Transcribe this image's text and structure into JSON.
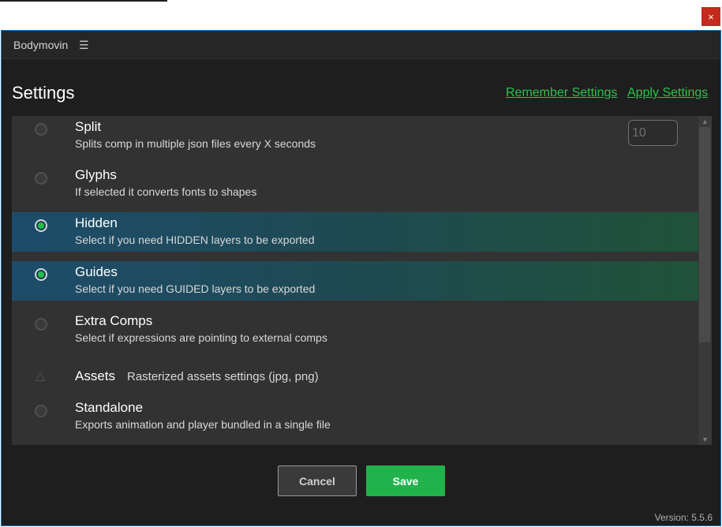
{
  "window": {
    "close_label": "×"
  },
  "header": {
    "app_title": "Bodymovin",
    "menu_icon": "☰"
  },
  "settings": {
    "title": "Settings",
    "remember_label": "Remember Settings",
    "apply_label": "Apply Settings"
  },
  "options": [
    {
      "title": "Split",
      "desc": "Splits comp in multiple json files every X seconds",
      "selected": false,
      "input_value": "10"
    },
    {
      "title": "Glyphs",
      "desc": "If selected it converts fonts to shapes",
      "selected": false
    },
    {
      "title": "Hidden",
      "desc": "Select if you need HIDDEN layers to be exported",
      "selected": true
    },
    {
      "title": "Guides",
      "desc": "Select if you need GUIDED layers to be exported",
      "selected": true
    },
    {
      "title": "Extra Comps",
      "desc": "Select if expressions are pointing to external comps",
      "selected": false
    },
    {
      "title": "Assets",
      "desc": "Rasterized assets settings (jpg, png)",
      "icon": "triangle-icon"
    },
    {
      "title": "Standalone",
      "desc": "Exports animation and player bundled in a single file",
      "selected": false
    }
  ],
  "scrollbar": {
    "up_arrow": "▲",
    "down_arrow": "▼"
  },
  "footer": {
    "cancel_label": "Cancel",
    "save_label": "Save",
    "version": "Version: 5.5.6"
  },
  "colors": {
    "accent": "#22b24c",
    "link": "#2fbf4f",
    "window_border": "#1a73b5",
    "close": "#c42b1c"
  }
}
